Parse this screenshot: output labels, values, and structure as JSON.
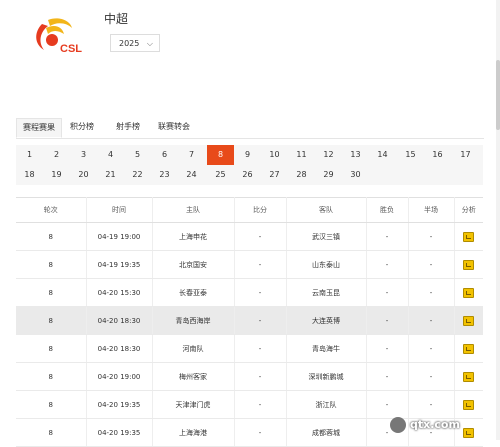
{
  "header": {
    "league_name": "中超",
    "year_value": "2025",
    "logo_text": "CSL"
  },
  "tabs": [
    {
      "label": "赛程赛果",
      "active": true
    },
    {
      "label": "积分榜",
      "active": false
    },
    {
      "label": "射手榜",
      "active": false
    },
    {
      "label": "联赛转会",
      "active": false
    }
  ],
  "rounds": [
    "1",
    "2",
    "3",
    "4",
    "5",
    "6",
    "7",
    "8",
    "9",
    "10",
    "11",
    "12",
    "13",
    "14",
    "15",
    "16",
    "17",
    "18",
    "19",
    "20",
    "21",
    "22",
    "23",
    "24",
    "25",
    "26",
    "27",
    "28",
    "29",
    "30"
  ],
  "active_round": "8",
  "table": {
    "headers": [
      "轮次",
      "时间",
      "主队",
      "比分",
      "客队",
      "胜负",
      "半场",
      "分析"
    ],
    "rows": [
      {
        "round": "8",
        "time": "04-19 19:00",
        "home": "上海申花",
        "score": "-",
        "away": "武汉三镇",
        "result": "-",
        "half": "-"
      },
      {
        "round": "8",
        "time": "04-19 19:35",
        "home": "北京国安",
        "score": "-",
        "away": "山东泰山",
        "result": "-",
        "half": "-"
      },
      {
        "round": "8",
        "time": "04-20 15:30",
        "home": "长春亚泰",
        "score": "-",
        "away": "云南玉昆",
        "result": "-",
        "half": "-"
      },
      {
        "round": "8",
        "time": "04-20 18:30",
        "home": "青岛西海岸",
        "score": "-",
        "away": "大连英博",
        "result": "-",
        "half": "-"
      },
      {
        "round": "8",
        "time": "04-20 18:30",
        "home": "河南队",
        "score": "-",
        "away": "青岛海牛",
        "result": "-",
        "half": "-"
      },
      {
        "round": "8",
        "time": "04-20 19:00",
        "home": "梅州客家",
        "score": "-",
        "away": "深圳新鹏城",
        "result": "-",
        "half": "-"
      },
      {
        "round": "8",
        "time": "04-20 19:35",
        "home": "天津津门虎",
        "score": "-",
        "away": "浙江队",
        "result": "-",
        "half": "-"
      },
      {
        "round": "8",
        "time": "04-20 19:35",
        "home": "上海海港",
        "score": "-",
        "away": "成都蓉城",
        "result": "-",
        "half": "-"
      }
    ],
    "highlight_row": 3
  },
  "watermark": {
    "text": "qtx.com"
  },
  "colors": {
    "accent": "#e84a1a",
    "row_highlight": "#eaeaea"
  },
  "icons": {
    "analysis": "analysis-chart-icon",
    "year_dropdown": "chevron-down-icon"
  }
}
